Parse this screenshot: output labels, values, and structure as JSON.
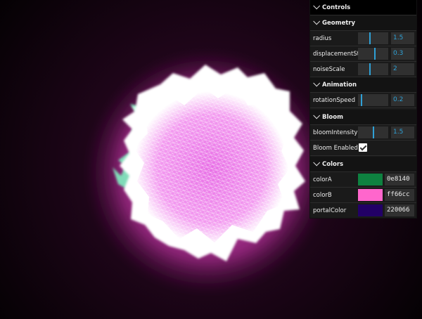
{
  "gui": {
    "title": "Controls",
    "folders": {
      "geometry": {
        "title": "Geometry",
        "radius": {
          "label": "radius",
          "value": "1.5",
          "fraction": 0.4
        },
        "displacementStrength": {
          "label": "displacementStrength",
          "value": "0.3",
          "fraction": 0.55
        },
        "noiseScale": {
          "label": "noiseScale",
          "value": "2",
          "fraction": 0.4
        }
      },
      "animation": {
        "title": "Animation",
        "rotationSpeed": {
          "label": "rotationSpeed",
          "value": "0.2",
          "fraction": 0.1
        }
      },
      "bloom": {
        "title": "Bloom",
        "bloomIntensity": {
          "label": "bloomIntensity",
          "value": "1.5",
          "fraction": 0.5
        },
        "bloomEnabled": {
          "label": "Bloom Enabled",
          "checked": true
        }
      },
      "colors": {
        "title": "Colors",
        "colorA": {
          "label": "colorA",
          "value": "0e8140",
          "color": "#0e8140"
        },
        "colorB": {
          "label": "colorB",
          "value": "ff66cc",
          "color": "#ff66cc"
        },
        "portalColor": {
          "label": "portalColor",
          "value": "220066",
          "color": "#220066"
        }
      }
    }
  }
}
